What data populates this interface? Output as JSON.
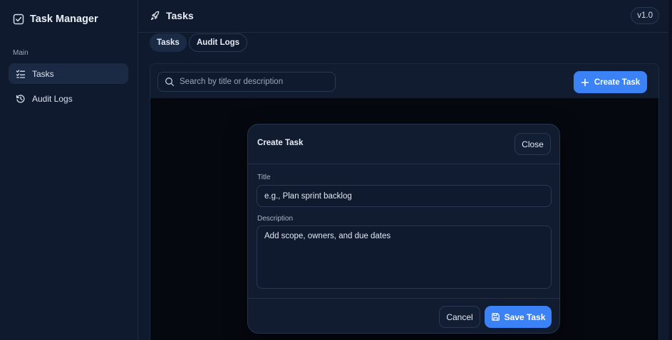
{
  "sidebar": {
    "brand": "Task Manager",
    "section_label": "Main",
    "items": [
      {
        "label": "Tasks",
        "icon": "list-check-icon",
        "active": true
      },
      {
        "label": "Audit Logs",
        "icon": "history-icon",
        "active": false
      }
    ]
  },
  "header": {
    "title": "Tasks",
    "icon": "rocket-icon",
    "version": "v1.0"
  },
  "tabs": [
    {
      "label": "Tasks",
      "active": true
    },
    {
      "label": "Audit Logs",
      "active": false
    }
  ],
  "toolbar": {
    "search_placeholder": "Search by title or description",
    "search_value": "",
    "create_label": "Create Task"
  },
  "modal": {
    "title": "Create Task",
    "close_label": "Close",
    "title_label": "Title",
    "title_placeholder": "e.g., Plan sprint backlog",
    "title_value": "",
    "description_label": "Description",
    "description_placeholder": "Add scope, owners, and due dates",
    "description_value": "",
    "cancel_label": "Cancel",
    "save_label": "Save Task"
  },
  "colors": {
    "accent": "#3b82f6",
    "background": "#0f1a2e",
    "overlay": "#05080f"
  }
}
